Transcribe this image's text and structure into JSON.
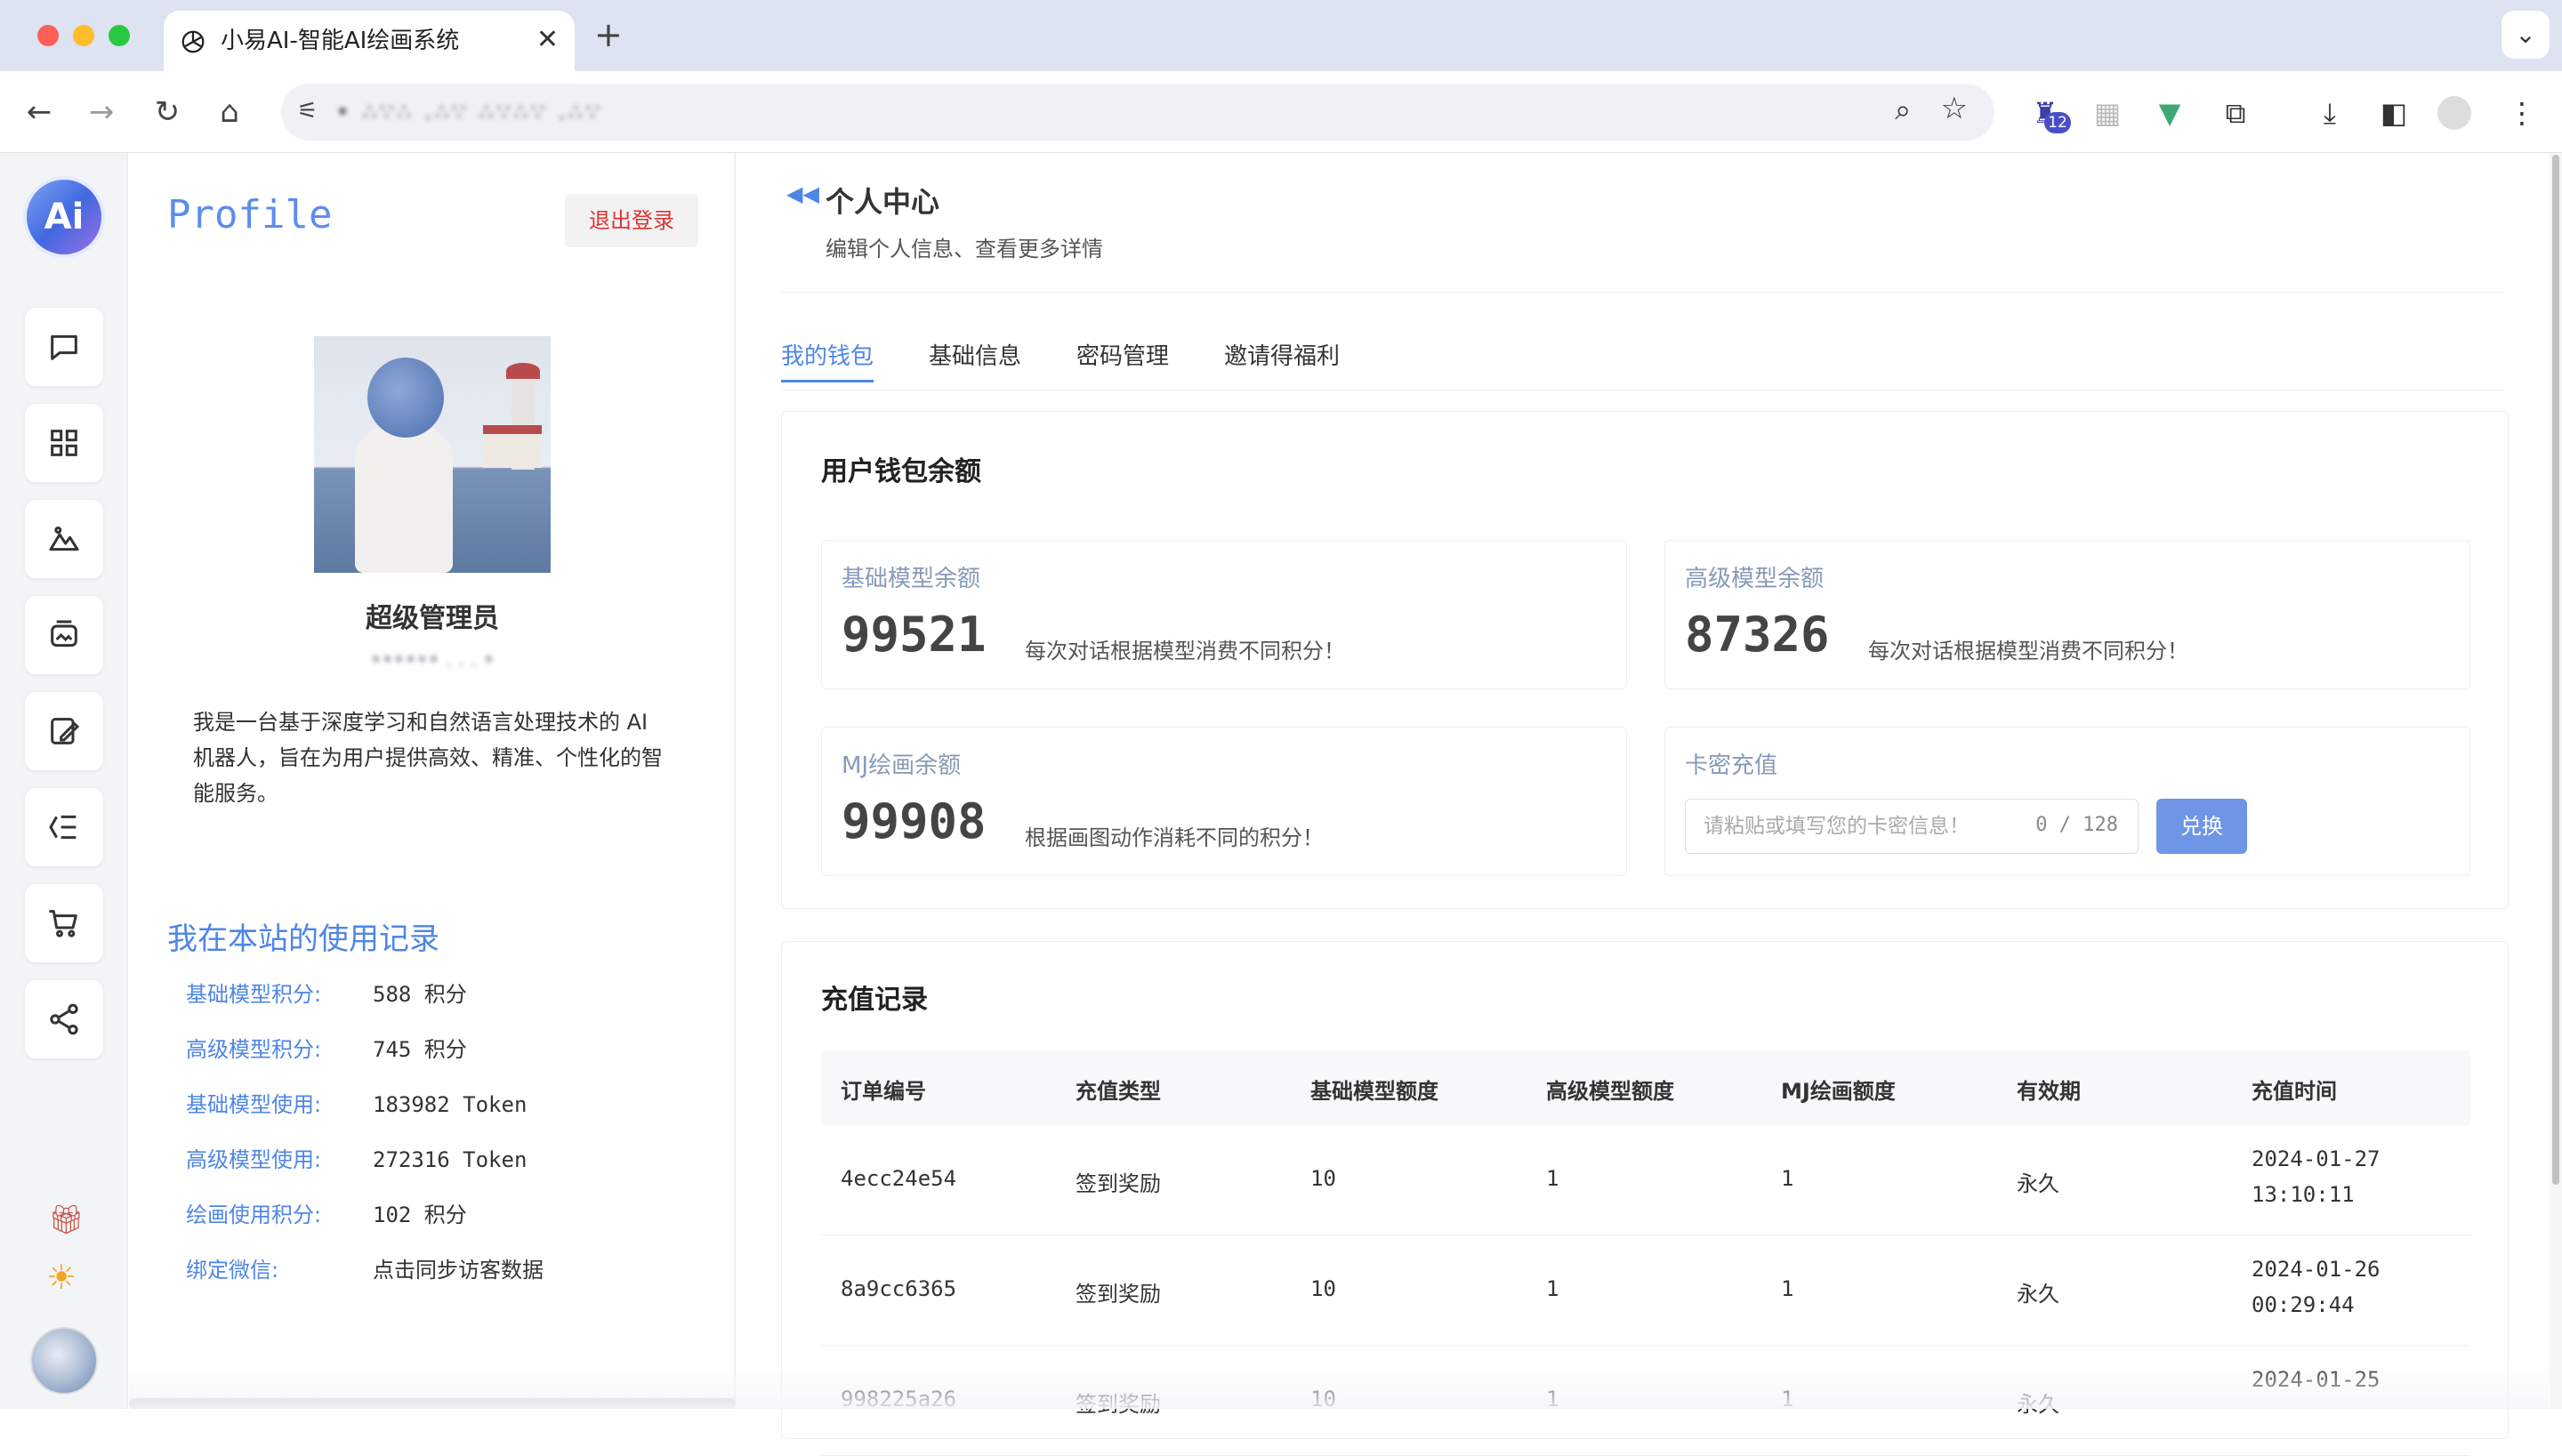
{
  "browser": {
    "tab_title": "小易AI-智能AI绘画系统",
    "tab_close": "✕",
    "new_tab": "+",
    "url": "• ∴∵∴ .∴∵ ∴∵∴∵ .∴∵",
    "extension_badge": "12"
  },
  "rail": {
    "logo_text": "Ai"
  },
  "profile": {
    "title": "Profile",
    "logout_label": "退出登录",
    "name": "超级管理员",
    "user_id": "•••••• . . . •",
    "bio": "我是一台基于深度学习和自然语言处理技术的 AI 机器人，旨在为用户提供高效、精准、个性化的智能服务。",
    "records_title": "我在本站的使用记录",
    "stats": [
      {
        "label": "基础模型积分:",
        "value": "588 积分"
      },
      {
        "label": "高级模型积分:",
        "value": "745 积分"
      },
      {
        "label": "基础模型使用:",
        "value": "183982 Token"
      },
      {
        "label": "高级模型使用:",
        "value": "272316 Token"
      },
      {
        "label": "绘画使用积分:",
        "value": "102 积分"
      },
      {
        "label": "绑定微信:",
        "value": "点击同步访客数据"
      }
    ]
  },
  "main": {
    "page_title": "个人中心",
    "page_subtitle": "编辑个人信息、查看更多详情",
    "tabs": [
      "我的钱包",
      "基础信息",
      "密码管理",
      "邀请得福利"
    ],
    "wallet": {
      "title": "用户钱包余额",
      "basic": {
        "label": "基础模型余额",
        "value": "99521",
        "note": "每次对话根据模型消费不同积分！"
      },
      "advanced": {
        "label": "高级模型余额",
        "value": "87326",
        "note": "每次对话根据模型消费不同积分！"
      },
      "mj": {
        "label": "MJ绘画余额",
        "value": "99908",
        "note": "根据画图动作消耗不同的积分！"
      },
      "card": {
        "label": "卡密充值",
        "placeholder": "请粘贴或填写您的卡密信息！",
        "counter": "0 / 128",
        "button": "兑换"
      }
    },
    "recharge": {
      "title": "充值记录",
      "columns": [
        "订单编号",
        "充值类型",
        "基础模型额度",
        "高级模型额度",
        "MJ绘画额度",
        "有效期",
        "充值时间"
      ],
      "rows": [
        {
          "id": "4ecc24e54",
          "type": "签到奖励",
          "basic": "10",
          "advanced": "1",
          "mj": "1",
          "validity": "永久",
          "date": "2024-01-27",
          "time": "13:10:11"
        },
        {
          "id": "8a9cc6365",
          "type": "签到奖励",
          "basic": "10",
          "advanced": "1",
          "mj": "1",
          "validity": "永久",
          "date": "2024-01-26",
          "time": "00:29:44"
        },
        {
          "id": "998225a26",
          "type": "签到奖励",
          "basic": "10",
          "advanced": "1",
          "mj": "1",
          "validity": "永久",
          "date": "2024-01-25",
          "time": ""
        }
      ]
    }
  }
}
